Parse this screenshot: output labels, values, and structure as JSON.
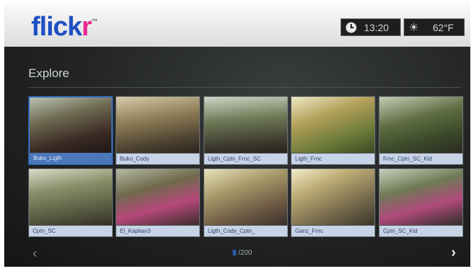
{
  "header": {
    "logo_part1": "flick",
    "logo_part2": "r",
    "logo_tm": "™",
    "clock_icon": "clock-icon",
    "time": "13:20",
    "weather_icon": "sun-icon",
    "temperature": "62°F"
  },
  "section": {
    "title": "Explore"
  },
  "photos": [
    {
      "caption": "Buko_Ligth",
      "selected": true
    },
    {
      "caption": "Buko_Cody",
      "selected": false
    },
    {
      "caption": "Ligth_Cptn_Frnc_SC",
      "selected": false
    },
    {
      "caption": "Ligth_Frnc",
      "selected": false
    },
    {
      "caption": "Frnc_Cptn_SC_Kid",
      "selected": false
    },
    {
      "caption": "Cptn_SC",
      "selected": false
    },
    {
      "caption": "El_Kapitan3",
      "selected": false
    },
    {
      "caption": "Ligth_Cody_Cptn_",
      "selected": false
    },
    {
      "caption": "Ganz_Frnc",
      "selected": false
    },
    {
      "caption": "Cptn_SC_Kid",
      "selected": false
    }
  ],
  "pagination": {
    "count": "/200",
    "prev_icon": "chevron-left-icon",
    "next_icon": "chevron-right-icon"
  },
  "colors": {
    "logo_blue": "#1d4fc4",
    "logo_pink": "#e8288f",
    "selection_blue": "#3b73c4"
  }
}
